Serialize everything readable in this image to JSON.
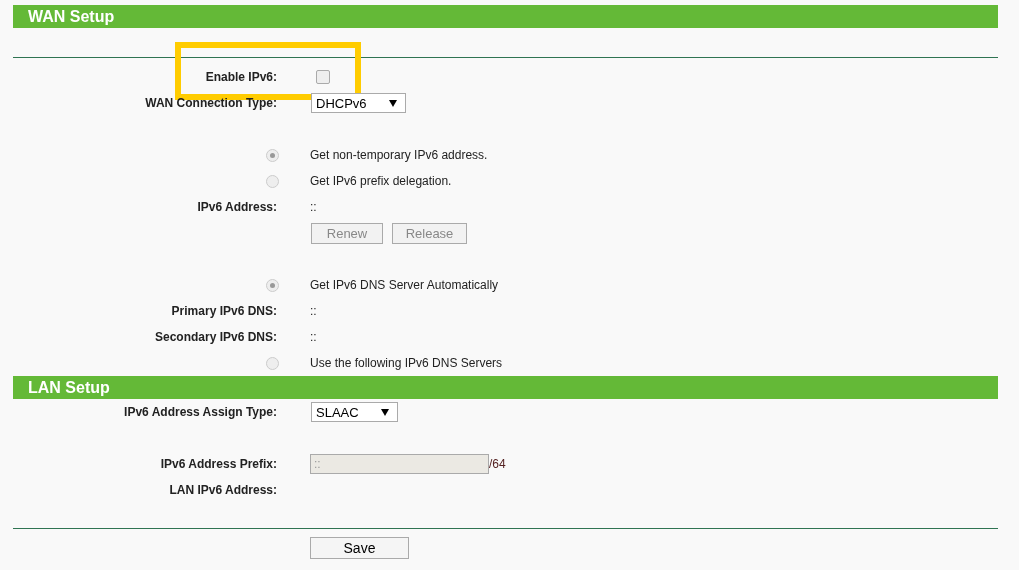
{
  "wan_setup": {
    "title": "WAN Setup",
    "groups": [
      [
        {
          "kind": "checkbox",
          "label": "Enable IPv6:",
          "checked": false,
          "highlighted": true
        },
        {
          "kind": "select",
          "label": "WAN Connection Type:",
          "value": "DHCPv6"
        }
      ],
      [
        {
          "kind": "radio",
          "text": "Get non-temporary IPv6 address.",
          "selected": true
        },
        {
          "kind": "radio",
          "text": "Get IPv6 prefix delegation.",
          "selected": false
        },
        {
          "kind": "text",
          "label": "IPv6 Address:",
          "value": "::"
        },
        {
          "kind": "buttons",
          "buttons": [
            {
              "label": "Renew",
              "disabled": true
            },
            {
              "label": "Release",
              "disabled": true
            }
          ]
        }
      ],
      [
        {
          "kind": "radio",
          "text": "Get IPv6 DNS Server Automatically",
          "selected": true
        },
        {
          "kind": "text",
          "label": "Primary IPv6 DNS:",
          "value": "::"
        },
        {
          "kind": "text",
          "label": "Secondary IPv6 DNS:",
          "value": "::"
        },
        {
          "kind": "radio",
          "text": "Use the following IPv6 DNS Servers",
          "selected": false
        }
      ]
    ]
  },
  "lan_setup": {
    "title": "LAN Setup",
    "groups": [
      [
        {
          "kind": "select",
          "label": "IPv6 Address Assign Type:",
          "value": "SLAAC"
        }
      ],
      [
        {
          "kind": "prefix",
          "label": "IPv6 Address Prefix:",
          "value": "::",
          "suffix": "/64"
        },
        {
          "kind": "text",
          "label": "LAN IPv6 Address:"
        }
      ]
    ]
  },
  "save_button": "Save"
}
